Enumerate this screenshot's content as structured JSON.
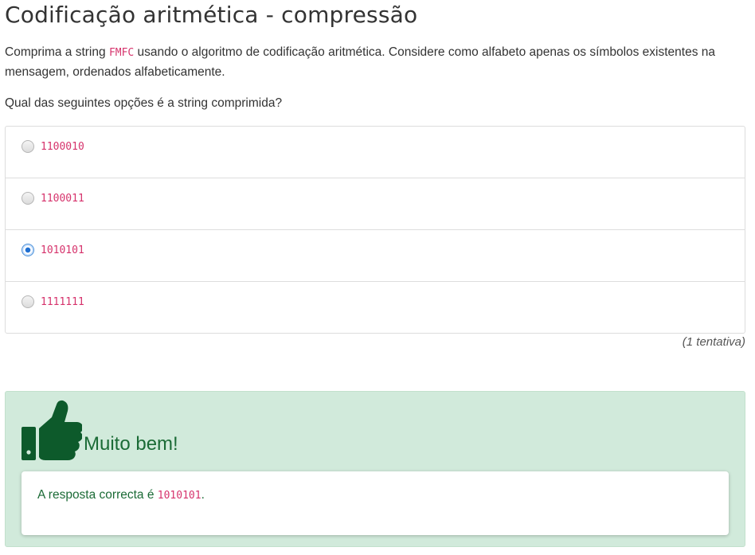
{
  "question": {
    "title": "Codificação aritmética - compressão",
    "p1_before": "Comprima a string ",
    "p1_code": "FMFC",
    "p1_after": " usando o algoritmo de codificação aritmética. Considere como alfabeto apenas os símbolos existentes na mensagem, ordenados alfabeticamente.",
    "prompt": "Qual das seguintes opções é a string comprimida?"
  },
  "options": [
    {
      "label": "1100010",
      "selected": false
    },
    {
      "label": "1100011",
      "selected": false
    },
    {
      "label": "1010101",
      "selected": true
    },
    {
      "label": "1111111",
      "selected": false
    }
  ],
  "attempts": "(1 tentativa)",
  "feedback": {
    "icon": "thumbs-up-icon",
    "title": "Muito bem!",
    "answer_before": "A resposta correcta é ",
    "answer_code": "1010101",
    "answer_after": "."
  },
  "colors": {
    "code": "#d6336c",
    "success_bg": "#d1eadb",
    "success_text": "#1b6b36"
  }
}
